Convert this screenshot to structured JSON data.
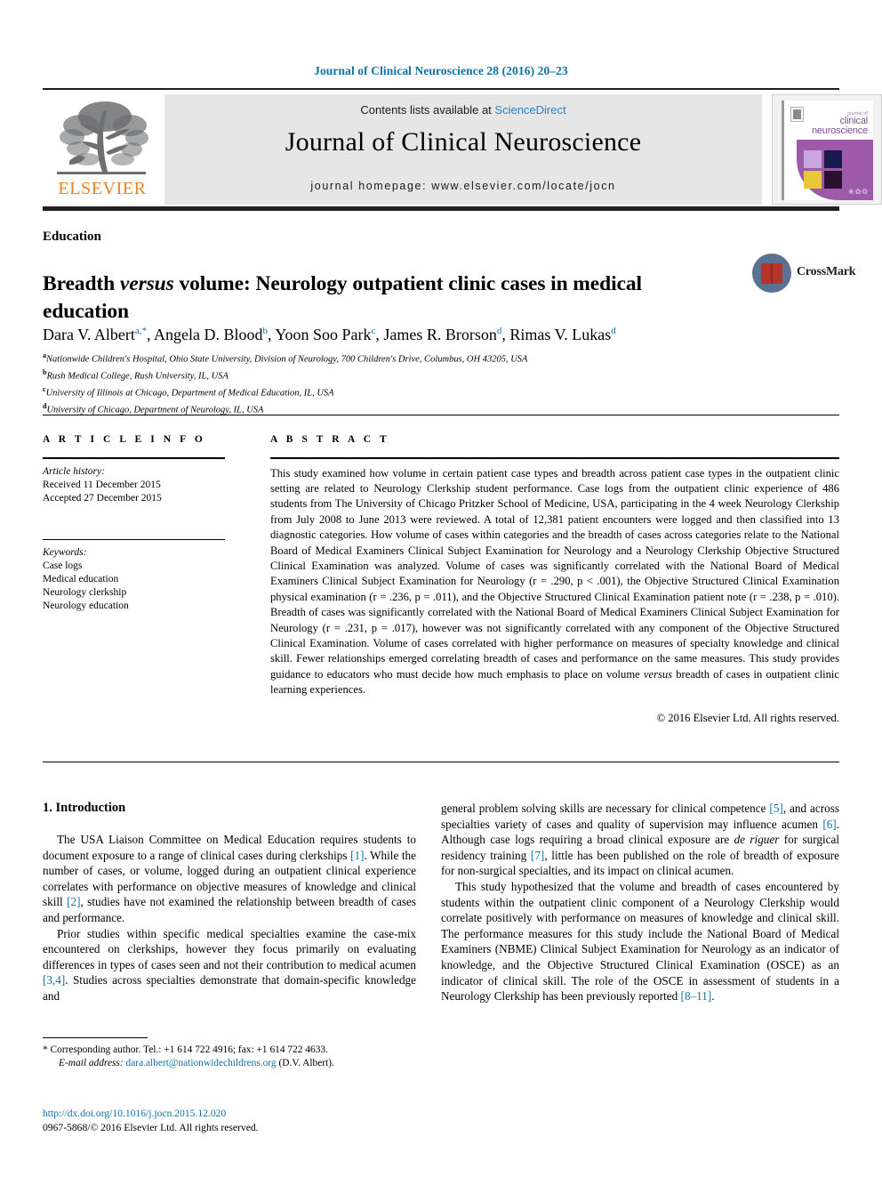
{
  "running_head": "Journal of Clinical Neuroscience 28 (2016) 20–23",
  "masthead": {
    "contents_prefix": "Contents lists available at ",
    "sciencedirect": "ScienceDirect",
    "journal_name": "Journal of Clinical Neuroscience",
    "homepage": "journal homepage: www.elsevier.com/locate/jocn",
    "publisher_wordmark": "ELSEVIER",
    "publisher_logo_icon": "elsevier-tree-icon",
    "cover": {
      "small_line": "journal of",
      "line1": "clinical",
      "line2": "neuroscience",
      "dots": "❀✿❂"
    }
  },
  "article": {
    "section_label": "Education",
    "title_part1": "Breadth ",
    "title_em": "versus",
    "title_part2": " volume: Neurology outpatient clinic cases in medical education",
    "crossmark_label": "CrossMark",
    "authors": [
      {
        "name": "Dara V. Albert",
        "sup": "a,*"
      },
      {
        "name": "Angela D. Blood",
        "sup": "b"
      },
      {
        "name": "Yoon Soo Park",
        "sup": "c"
      },
      {
        "name": "James R. Brorson",
        "sup": "d"
      },
      {
        "name": "Rimas V. Lukas",
        "sup": "d"
      }
    ],
    "affiliations": [
      {
        "marker": "a",
        "text": "Nationwide Children's Hospital, Ohio State University, Division of Neurology, 700 Children's Drive, Columbus, OH 43205, USA"
      },
      {
        "marker": "b",
        "text": "Rush Medical College, Rush University, IL, USA"
      },
      {
        "marker": "c",
        "text": "University of Illinois at Chicago, Department of Medical Education, IL, USA"
      },
      {
        "marker": "d",
        "text": "University of Chicago, Department of Neurology, IL, USA"
      }
    ]
  },
  "article_info": {
    "heading": "A R T I C L E  I N F O",
    "history_label": "Article history:",
    "received": "Received 11 December 2015",
    "accepted": "Accepted 27 December 2015",
    "keywords_label": "Keywords:",
    "keywords": [
      "Case logs",
      "Medical education",
      "Neurology clerkship",
      "Neurology education"
    ]
  },
  "abstract": {
    "heading": "A B S T R A C T",
    "text": "This study examined how volume in certain patient case types and breadth across patient case types in the outpatient clinic setting are related to Neurology Clerkship student performance. Case logs from the outpatient clinic experience of 486 students from The University of Chicago Pritzker School of Medicine, USA, participating in the 4 week Neurology Clerkship from July 2008 to June 2013 were reviewed. A total of 12,381 patient encounters were logged and then classified into 13 diagnostic categories. How volume of cases within categories and the breadth of cases across categories relate to the National Board of Medical Examiners Clinical Subject Examination for Neurology and a Neurology Clerkship Objective Structured Clinical Examination was analyzed. Volume of cases was significantly correlated with the National Board of Medical Examiners Clinical Subject Examination for Neurology (r = .290, p < .001), the Objective Structured Clinical Examination physical examination (r = .236, p = .011), and the Objective Structured Clinical Examination patient note (r = .238, p = .010). Breadth of cases was significantly correlated with the National Board of Medical Examiners Clinical Subject Examination for Neurology (r = .231, p = .017), however was not significantly correlated with any component of the Objective Structured Clinical Examination. Volume of cases correlated with higher performance on measures of specialty knowledge and clinical skill. Fewer relationships emerged correlating breadth of cases and performance on the same measures. This study provides guidance to educators who must decide how much emphasis to place on volume versus breadth of cases in outpatient clinic learning experiences.",
    "copyright": "© 2016 Elsevier Ltd. All rights reserved."
  },
  "body": {
    "intro_heading": "1. Introduction",
    "left_paragraphs": [
      "The USA Liaison Committee on Medical Education requires students to document exposure to a range of clinical cases during clerkships [1]. While the number of cases, or volume, logged during an outpatient clinical experience correlates with performance on objective measures of knowledge and clinical skill [2], studies have not examined the relationship between breadth of cases and performance.",
      "Prior studies within specific medical specialties examine the case-mix encountered on clerkships, however they focus primarily on evaluating differences in types of cases seen and not their contribution to medical acumen [3,4]. Studies across specialties demonstrate that domain-specific knowledge and"
    ],
    "right_paragraphs": [
      "general problem solving skills are necessary for clinical competence [5], and across specialties variety of cases and quality of supervision may influence acumen [6]. Although case logs requiring a broad clinical exposure are de riguer for surgical residency training [7], little has been published on the role of breadth of exposure for non-surgical specialties, and its impact on clinical acumen.",
      "This study hypothesized that the volume and breadth of cases encountered by students within the outpatient clinic component of a Neurology Clerkship would correlate positively with performance on measures of knowledge and clinical skill. The performance measures for this study include the National Board of Medical Examiners (NBME) Clinical Subject Examination for Neurology as an indicator of knowledge, and the Objective Structured Clinical Examination (OSCE) as an indicator of clinical skill. The role of the OSCE in assessment of students in a Neurology Clerkship has been previously reported [8–11]."
    ]
  },
  "footer": {
    "corresponding_author": "* Corresponding author. Tel.: +1 614 722 4916; fax: +1 614 722 4633.",
    "email_label": "E-mail address:",
    "email": "dara.albert@nationwidechildrens.org",
    "email_owner": "(D.V. Albert).",
    "doi": "http://dx.doi.org/10.1016/j.jocn.2015.12.020",
    "issn_line": "0967-5868/© 2016 Elsevier Ltd. All rights reserved."
  },
  "colors": {
    "link": "#1070a8",
    "sciencedirect": "#2e7fc1",
    "elsevier_orange": "#f08122",
    "band": "#e6e6e6",
    "cover_purple": "#9d5aa9"
  }
}
